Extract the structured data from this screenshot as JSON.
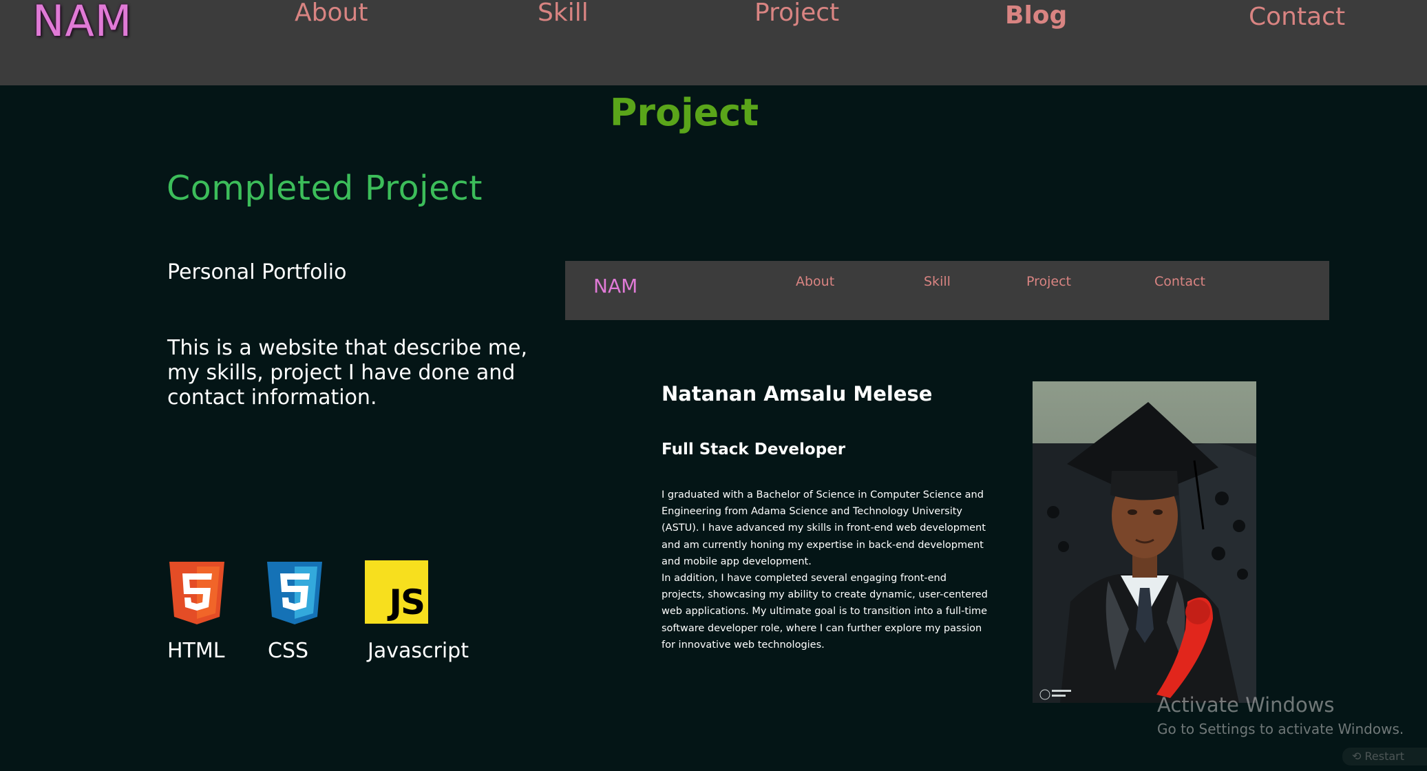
{
  "nav": {
    "brand": "NAM",
    "about": "About",
    "skill": "Skill",
    "project": "Project",
    "blog": "Blog",
    "contact": "Contact"
  },
  "page": {
    "heading": "Project",
    "section_heading": "Completed Project"
  },
  "project": {
    "title": "Personal Portfolio",
    "description": "This is a website that describe me, my skills, project I have done and contact information.",
    "tech": [
      {
        "icon": "html5-icon",
        "label": "HTML",
        "color": "#e44d26"
      },
      {
        "icon": "css3-icon",
        "label": "CSS",
        "color": "#1572b6"
      },
      {
        "icon": "js-icon",
        "label": "Javascript",
        "badge": "JS",
        "color": "#f7df1e"
      }
    ]
  },
  "preview": {
    "nav": {
      "brand": "NAM",
      "about": "About",
      "skill": "Skill",
      "project": "Project",
      "contact": "Contact"
    },
    "name": "Natanan Amsalu Melese",
    "role": "Full Stack Developer",
    "bio_1": "I graduated with a Bachelor of Science in Computer Science and Engineering from Adama Science and Technology University (ASTU). I have advanced my skills in front-end web development and am currently honing my expertise in back-end development and mobile app development.",
    "bio_2": "In addition, I have completed several engaging front-end projects, showcasing my ability to create dynamic, user-centered web applications. My ultimate goal is to transition into a full-time software developer role, where I can further explore my passion for innovative web technologies."
  },
  "watermark": {
    "title": "Activate Windows",
    "subtitle": "Go to Settings to activate Windows.",
    "restart": "Restart"
  },
  "colors": {
    "background": "#041516",
    "nav_bg": "#3c3c3c",
    "brand": "#e07ad6",
    "nav_link": "#d98482",
    "heading_green": "#5aa51a",
    "section_green": "#3cbd5a"
  }
}
